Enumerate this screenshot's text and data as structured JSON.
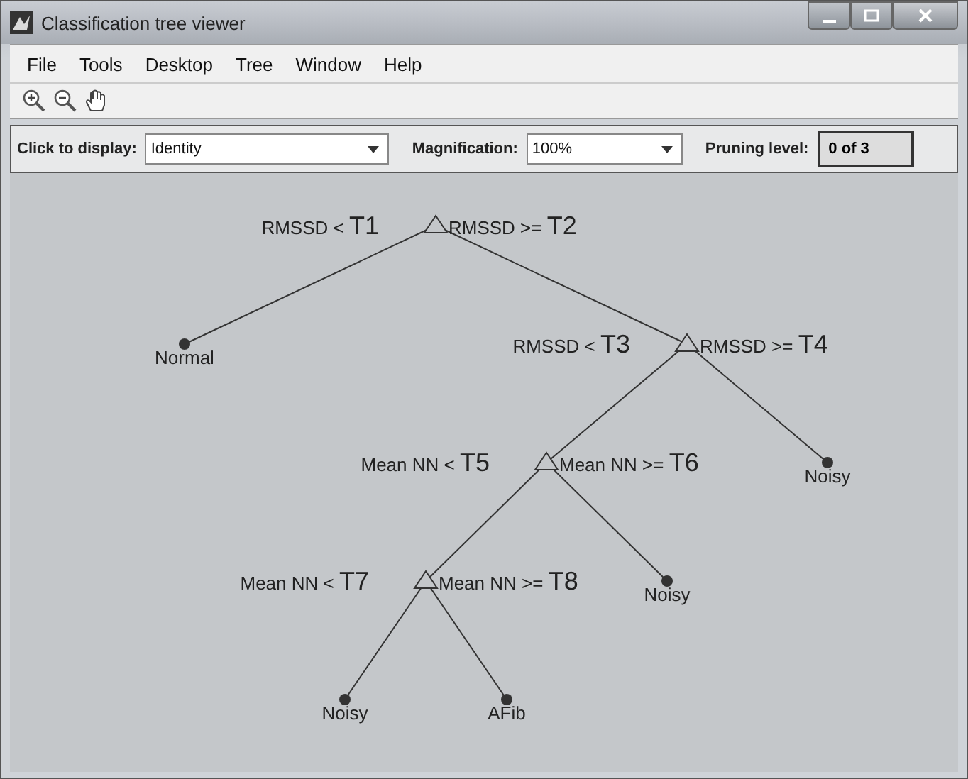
{
  "window": {
    "title": "Classification tree viewer"
  },
  "menu": [
    "File",
    "Tools",
    "Desktop",
    "Tree",
    "Window",
    "Help"
  ],
  "toolbar": [
    {
      "kind": "zoom-in"
    },
    {
      "kind": "zoom-out"
    },
    {
      "kind": "pan"
    }
  ],
  "controls": {
    "display_label": "Click to display:",
    "display_value": "Identity",
    "magnification_label": "Magnification:",
    "magnification_value": "100%",
    "pruning_label": "Pruning level:",
    "pruning_value": "0 of 3"
  },
  "tree": {
    "kind": "split",
    "left_label": {
      "text": "RMSSD <",
      "threshold": "T1"
    },
    "right_label": {
      "text": "RMSSD >=",
      "threshold": "T2"
    },
    "children": [
      {
        "kind": "leaf",
        "label": "Normal"
      },
      {
        "kind": "split",
        "left_label": {
          "text": "RMSSD <",
          "threshold": "T3"
        },
        "right_label": {
          "text": "RMSSD >=",
          "threshold": "T4"
        },
        "children": [
          {
            "kind": "split",
            "left_label": {
              "text": "Mean NN <",
              "threshold": "T5"
            },
            "right_label": {
              "text": "Mean NN >=",
              "threshold": "T6"
            },
            "children": [
              {
                "kind": "split",
                "left_label": {
                  "text": "Mean NN <",
                  "threshold": "T7"
                },
                "right_label": {
                  "text": "Mean NN >=",
                  "threshold": "T8"
                },
                "children": [
                  {
                    "kind": "leaf",
                    "label": "Noisy"
                  },
                  {
                    "kind": "leaf",
                    "label": "AFib"
                  }
                ]
              },
              {
                "kind": "leaf",
                "label": "Noisy"
              }
            ]
          },
          {
            "kind": "leaf",
            "label": "Noisy"
          }
        ]
      }
    ]
  }
}
